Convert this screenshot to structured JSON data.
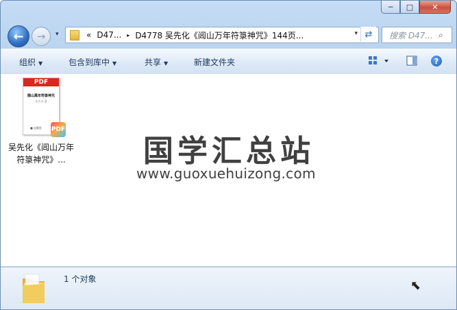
{
  "window": {
    "minimize": "─",
    "maximize": "□",
    "close": "✕"
  },
  "nav": {
    "back_icon": "back-arrow-icon",
    "forward_icon": "forward-arrow-icon",
    "history_arrow": "▾",
    "breadcrumb_overflow": "«",
    "breadcrumb_parent": "D47...",
    "breadcrumb_sep": "▸",
    "breadcrumb_current": "D4778 吴先化《阊山万年符箓神咒》144页...",
    "address_dropdown": "▾",
    "search_placeholder": "搜索 D47..."
  },
  "toolbar": {
    "organize": "组织",
    "include_in_library": "包含到库中",
    "share": "共享",
    "new_folder": "新建文件夹",
    "dropdown_arrow": "▼"
  },
  "content": {
    "files": [
      {
        "name": "吴先化《阊山万年符箓神咒》...",
        "type": "PDF",
        "thumb_title": "閭山萬年符箓神咒",
        "thumb_sub": "吴先化 著",
        "thumb_footer": "■ 出版社",
        "badge": "PDF"
      }
    ],
    "watermark_cn": "国学汇总站",
    "watermark_url": "www.guoxuehuizong.com"
  },
  "status": {
    "count": "1 个对象"
  },
  "colors": {
    "pdf_red": "#d62a20",
    "window_frame": "#b9d3ef"
  }
}
